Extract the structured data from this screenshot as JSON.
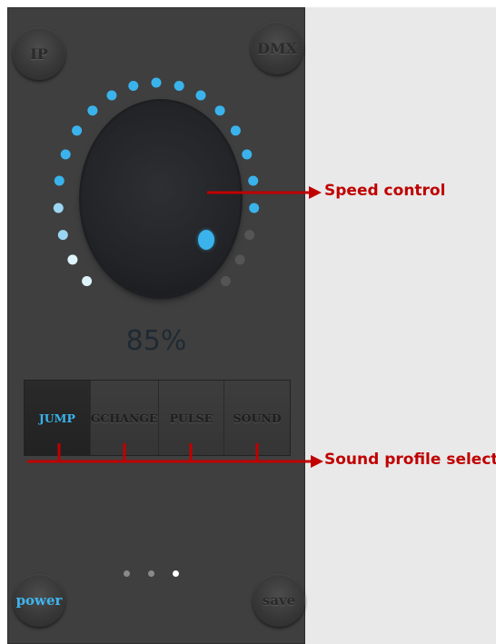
{
  "top_buttons": {
    "ip_label": "IP",
    "dmx_label": "DMX"
  },
  "speed": {
    "value_text": "85%",
    "value_fraction": 0.85
  },
  "sound_profiles": {
    "tabs": [
      "JUMP",
      "GCHANGE",
      "PULSE",
      "SOUND"
    ],
    "selected": "JUMP"
  },
  "pager": {
    "pages": 3,
    "current": 3
  },
  "bottom_buttons": {
    "power_label": "power",
    "save_label": "save"
  },
  "annotations": {
    "speed_control": "Speed control",
    "sound_profile_select": "Sound profile select"
  },
  "colors": {
    "accent": "#3ab3ec",
    "annotation": "#c00000",
    "panel": "#3f3f3f"
  }
}
